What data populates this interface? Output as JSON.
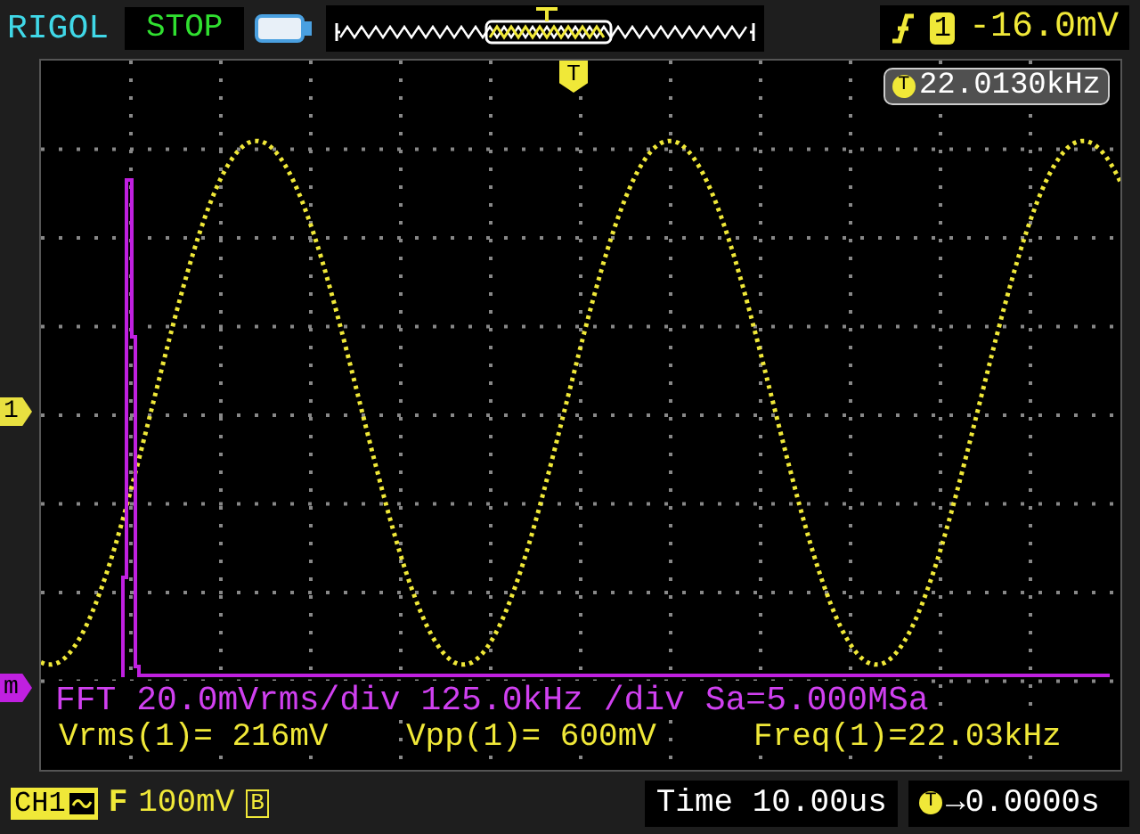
{
  "header": {
    "brand": "RIGOL",
    "run_state": "STOP",
    "trigger": {
      "channel": "1",
      "level": "-16.0mV"
    }
  },
  "screen": {
    "trigger_marker": "T",
    "frequency_badge": {
      "icon": "T",
      "value": "22.0130kHz"
    },
    "channel_markers": [
      {
        "label": "1",
        "color": "#e8e040"
      },
      {
        "label": "m",
        "color": "#c020e0"
      }
    ],
    "fft_info": "FFT 20.0mVrms/div 125.0kHz /div Sa=5.000MSa",
    "measurements": [
      "Vrms(1)= 216mV",
      "Vpp(1)= 600mV",
      "Freq(1)=22.03kHz"
    ]
  },
  "footer": {
    "channel": {
      "label": "CH1",
      "coupling_letter": "F",
      "scale": "100mV",
      "bandwidth_mark": "B"
    },
    "time": {
      "label": "Time",
      "value": "10.00us"
    },
    "offset": {
      "icon": "T",
      "value": "→0.0000s"
    }
  }
}
